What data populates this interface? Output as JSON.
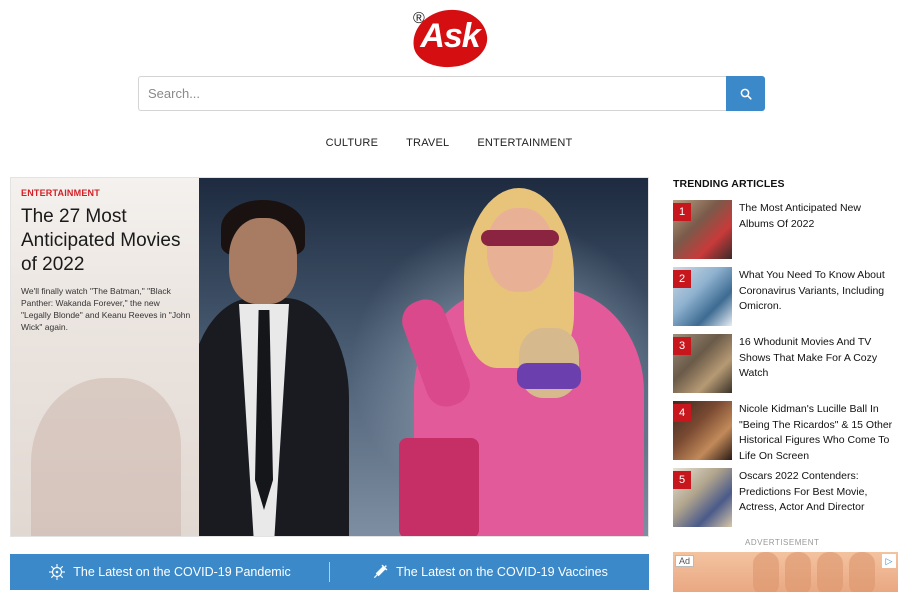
{
  "logo": {
    "text": "Ask",
    "reg": "®",
    "color": "#d50e12"
  },
  "search": {
    "placeholder": "Search...",
    "value": "",
    "icon": "search-icon",
    "button_color": "#3b89c9"
  },
  "nav": {
    "items": [
      "CULTURE",
      "TRAVEL",
      "ENTERTAINMENT"
    ]
  },
  "hero": {
    "category": "ENTERTAINMENT",
    "title": "The 27 Most Anticipated Movies of 2022",
    "description": "We'll finally watch \"The Batman,\" \"Black Panther: Wakanda Forever,\" the new \"Legally Blonde\" and Keanu Reeves in \"John Wick\" again.",
    "category_color": "#d31f26"
  },
  "covid": {
    "pandemic_label": "The Latest on the COVID-19 Pandemic",
    "pandemic_icon": "virus-icon",
    "vaccines_label": "The Latest on the COVID-19 Vaccines",
    "vaccines_icon": "syringe-icon"
  },
  "trending": {
    "heading": "TRENDING ARTICLES",
    "items": [
      {
        "num": "1",
        "title": "The Most Anticipated New Albums Of 2022"
      },
      {
        "num": "2",
        "title": "What You Need To Know About Coronavirus Variants, Including Omicron."
      },
      {
        "num": "3",
        "title": "16 Whodunit Movies And TV Shows That Make For A Cozy Watch"
      },
      {
        "num": "4",
        "title": "Nicole Kidman's Lucille Ball In \"Being The Ricardos\" & 15 Other Historical Figures Who Come To Life On Screen"
      },
      {
        "num": "5",
        "title": "Oscars 2022 Contenders: Predictions For Best Movie, Actress, Actor And Director"
      }
    ]
  },
  "ad": {
    "label": "ADVERTISEMENT",
    "tag": "Ad",
    "info": "▷"
  }
}
